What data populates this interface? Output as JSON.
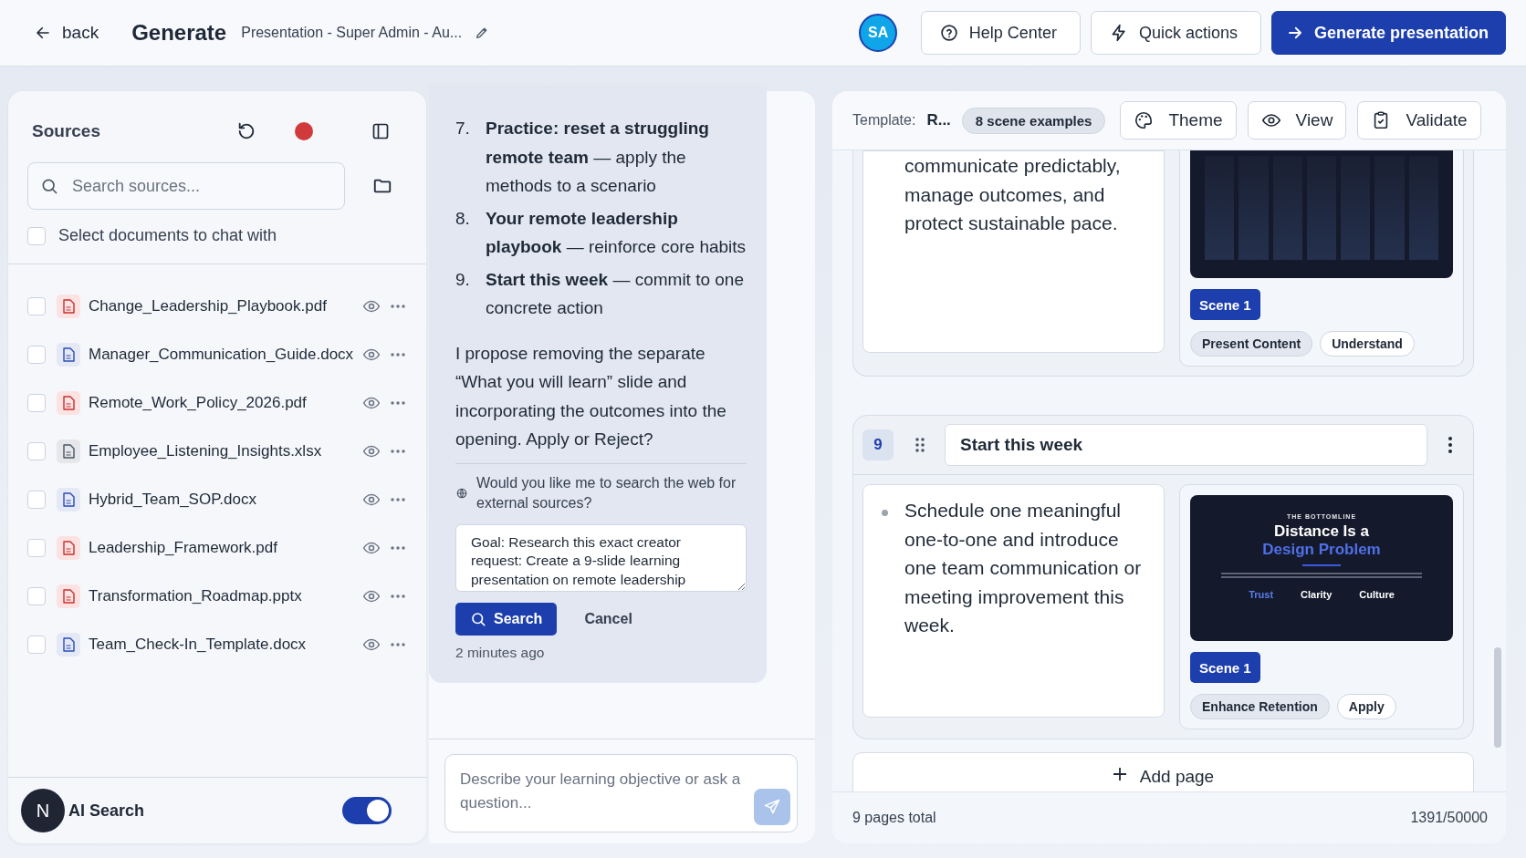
{
  "header": {
    "back": "back",
    "title": "Generate",
    "document": "Presentation - Super Admin - Au...",
    "avatar": "SA",
    "buttons": [
      {
        "label": "Help Center",
        "kind": "help"
      },
      {
        "label": "Quick actions",
        "kind": "quick"
      },
      {
        "label": "Generate presentation",
        "kind": "primary"
      }
    ]
  },
  "sources": {
    "title": "Sources",
    "search": {
      "placeholder": "Search sources..."
    },
    "select_all": {
      "label": "Select documents to chat with",
      "checked": false
    },
    "files": [
      {
        "name": "Change_Leadership_Playbook.pdf",
        "kind": "pdf",
        "checked": false
      },
      {
        "name": "Manager_Communication_Guide.docx",
        "kind": "docx",
        "checked": false
      },
      {
        "name": "Remote_Work_Policy_2026.pdf",
        "kind": "pdf",
        "checked": false
      },
      {
        "name": "Employee_Listening_Insights.xlsx",
        "kind": "xlsx",
        "checked": false
      },
      {
        "name": "Hybrid_Team_SOP.docx",
        "kind": "docx",
        "checked": false
      },
      {
        "name": "Leadership_Framework.pdf",
        "kind": "pdf",
        "checked": false
      },
      {
        "name": "Transformation_Roadmap.pptx",
        "kind": "pptx",
        "checked": false
      },
      {
        "name": "Team_Check-In_Template.docx",
        "kind": "docx",
        "checked": false
      }
    ],
    "user_initial": "N",
    "ai_search": {
      "label": "AI Search",
      "on": true
    }
  },
  "chat": {
    "list": [
      {
        "number": "7.",
        "text": "**Practice: reset a struggling remote team** — apply the methods to a scenario"
      },
      {
        "number": "8.",
        "text": "**Your remote leadership playbook** — reinforce core habits"
      },
      {
        "number": "9.",
        "text": "**Start this week** — commit to one concrete action"
      }
    ],
    "proposal": "I propose removing the separate “What you will learn” slide and incorporating the outcomes into the opening. Apply or Reject?",
    "web_prompt": "Would you like me to search the web for external sources?",
    "query": "Goal: Research this exact creator request: Create a 9-slide learning presentation on remote leadership",
    "search_button": "Search",
    "cancel_button": "Cancel",
    "time": "2 minutes ago",
    "composer": {
      "placeholder": "Describe your learning objective or ask a question..."
    }
  },
  "editor": {
    "template_label": "Template:",
    "template_value": "R...",
    "scene_examples": "8 scene examples",
    "tools": [
      {
        "label": "Theme",
        "kind": "theme"
      },
      {
        "label": "View",
        "kind": "view"
      },
      {
        "label": "Validate",
        "kind": "validate"
      }
    ],
    "pages": [
      {
        "bullet": false,
        "text": "communicate predictably, manage outcomes, and protect sustainable pace.",
        "thumbnail": {
          "kind": "columns"
        },
        "scene": "Scene 1",
        "tags": [
          {
            "label": "Present Content",
            "kind": "goal"
          },
          {
            "label": "Understand",
            "kind": "level"
          }
        ]
      },
      {
        "number": "9",
        "title": "Start this week",
        "bullet": true,
        "text": "Schedule one meaningful one-to-one and introduce one team communication or meeting improvement this week.",
        "thumbnail": {
          "kind": "title",
          "kicker": "THE BOTTOMLINE",
          "heading": "Distance Is a",
          "highlight": "Design Problem",
          "pillars": [
            {
              "label": "Trust",
              "accent": true
            },
            {
              "label": "Clarity",
              "accent": false
            },
            {
              "label": "Culture",
              "accent": false
            }
          ]
        },
        "scene": "Scene 1",
        "tags": [
          {
            "label": "Enhance Retention",
            "kind": "goal"
          },
          {
            "label": "Apply",
            "kind": "level"
          }
        ]
      }
    ],
    "add_page": "Add page",
    "pages_total": "9 pages total",
    "count": "1391/50000"
  }
}
